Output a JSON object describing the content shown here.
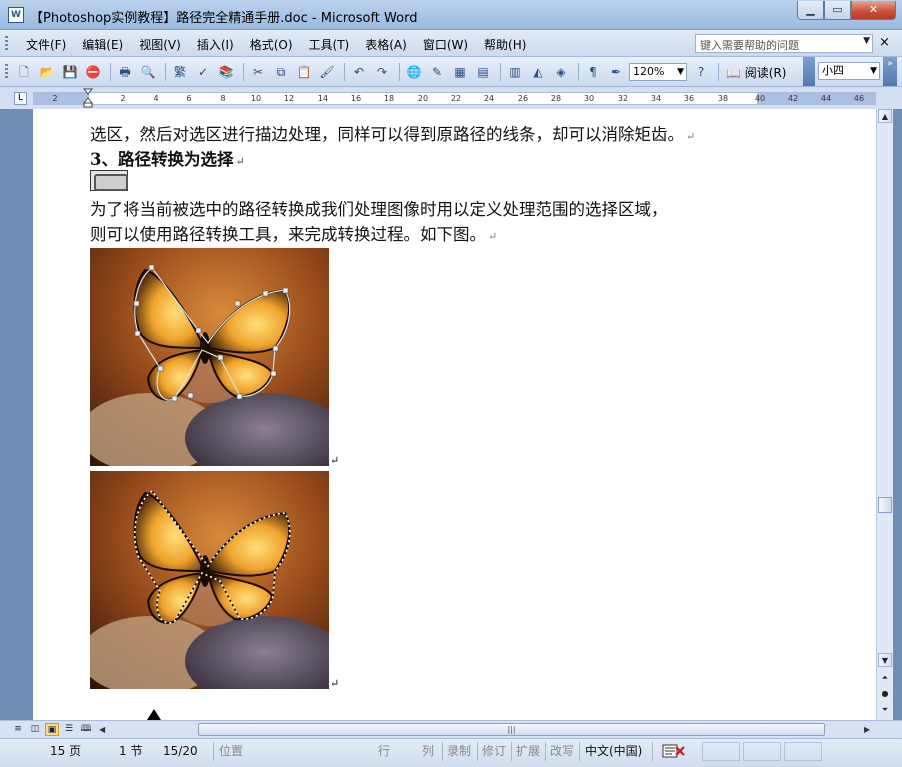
{
  "window": {
    "title": "【Photoshop实例教程】路径完全精通手册.doc - Microsoft Word",
    "app_icon": "W",
    "controls": {
      "minimize": "▁",
      "maximize": "▭",
      "close": "✕"
    }
  },
  "menu": {
    "items": [
      "文件(F)",
      "编辑(E)",
      "视图(V)",
      "插入(I)",
      "格式(O)",
      "工具(T)",
      "表格(A)",
      "窗口(W)",
      "帮助(H)"
    ],
    "help_placeholder": "键入需要帮助的问题",
    "close": "×"
  },
  "toolbar": {
    "zoom": "120%",
    "read_label": "阅读(R)",
    "font_size": "小四",
    "trad_label": "繁"
  },
  "ruler": {
    "ticks": [
      "2",
      "2",
      "4",
      "6",
      "8",
      "10",
      "12",
      "14",
      "16",
      "18",
      "20",
      "22",
      "24",
      "26",
      "28",
      "30",
      "32",
      "34",
      "36",
      "38",
      "40",
      "42",
      "44",
      "46"
    ]
  },
  "document": {
    "line1": "选区，然后对选区进行描边处理，同样可以得到原路径的线条，却可以消除矩齿。",
    "heading": "3、路径转换为选择",
    "para1": "为了将当前被选中的路径转换成我们处理图像时用以定义处理范围的选择区域，",
    "para2": "则可以使用路径转换工具，来完成转换过程。如下图。",
    "para_mark": "↵"
  },
  "statusbar": {
    "page": "15 页",
    "section": "1 节",
    "page_of": "15/20",
    "position": "位置",
    "row": "行",
    "col": "列",
    "rec": "录制",
    "trk": "修订",
    "ext": "扩展",
    "ovr": "改写",
    "language": "中文(中国)"
  },
  "colors": {
    "titlebar": "#a9c4e6",
    "page_bg": "#ffffff",
    "workspace": "#6f8db4"
  }
}
